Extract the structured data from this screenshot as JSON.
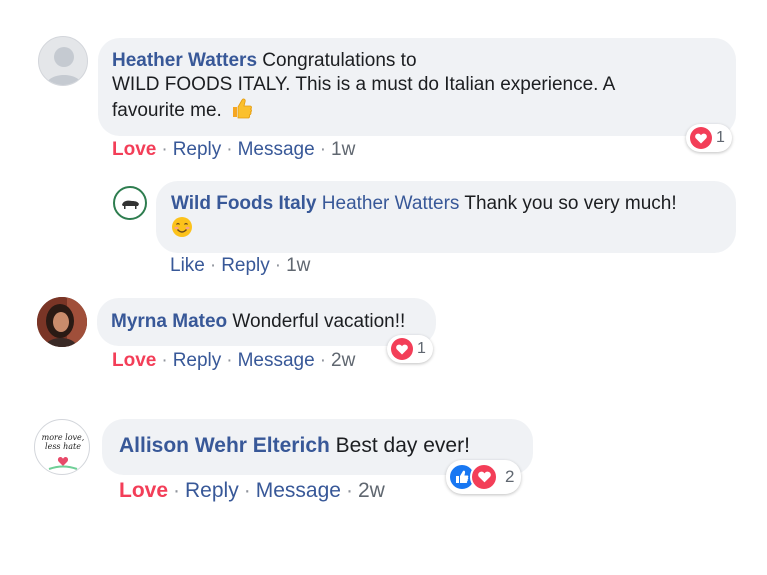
{
  "comments": [
    {
      "author": "Heather Watters",
      "text_line1": "Congratulations to",
      "text_line2": "WILD FOODS ITALY. This is a must do Italian experience. A",
      "text_line3": "favourite me.",
      "emoji_icon": "thumbs-up-emoji",
      "reaction_count": "1",
      "actions": {
        "love": "Love",
        "reply": "Reply",
        "message": "Message",
        "time": "1w"
      }
    },
    {
      "author": "Wild Foods Italy",
      "mention": "Heather Watters",
      "text": "Thank you so very much!",
      "emoji_icon": "smiling-face-emoji",
      "actions": {
        "like": "Like",
        "reply": "Reply",
        "time": "1w"
      }
    },
    {
      "author": "Myrna Mateo",
      "text": "Wonderful vacation!!",
      "reaction_count": "1",
      "actions": {
        "love": "Love",
        "reply": "Reply",
        "message": "Message",
        "time": "2w"
      }
    },
    {
      "author": "Allison Wehr Elterich",
      "text": "Best day ever!",
      "reaction_count": "2",
      "actions": {
        "love": "Love",
        "reply": "Reply",
        "message": "Message",
        "time": "2w"
      }
    }
  ],
  "avatar_text": {
    "line1": "more love,",
    "line2": "less hate"
  },
  "colors": {
    "name": "#385898",
    "love": "#f33e58",
    "bubble": "#f0f2f5",
    "like_blue": "#1877f2"
  }
}
